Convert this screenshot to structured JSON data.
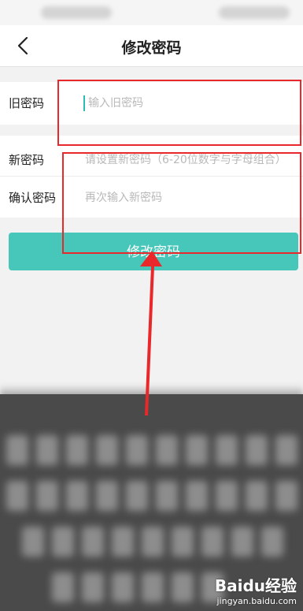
{
  "header": {
    "title": "修改密码",
    "back_icon": "chevron-left-icon"
  },
  "form": {
    "old_password": {
      "label": "旧密码",
      "placeholder": "输入旧密码"
    },
    "new_password": {
      "label": "新密码",
      "placeholder": "请设置新密码（6-20位数字与字母组合）"
    },
    "confirm_password": {
      "label": "确认密码",
      "placeholder": "再次输入新密码"
    },
    "submit_label": "修改密码"
  },
  "colors": {
    "accent": "#47c7b9",
    "annotation": "#e8282a"
  },
  "watermark": {
    "brand": "Baidu经验",
    "url": "jingyan.baidu.com"
  }
}
